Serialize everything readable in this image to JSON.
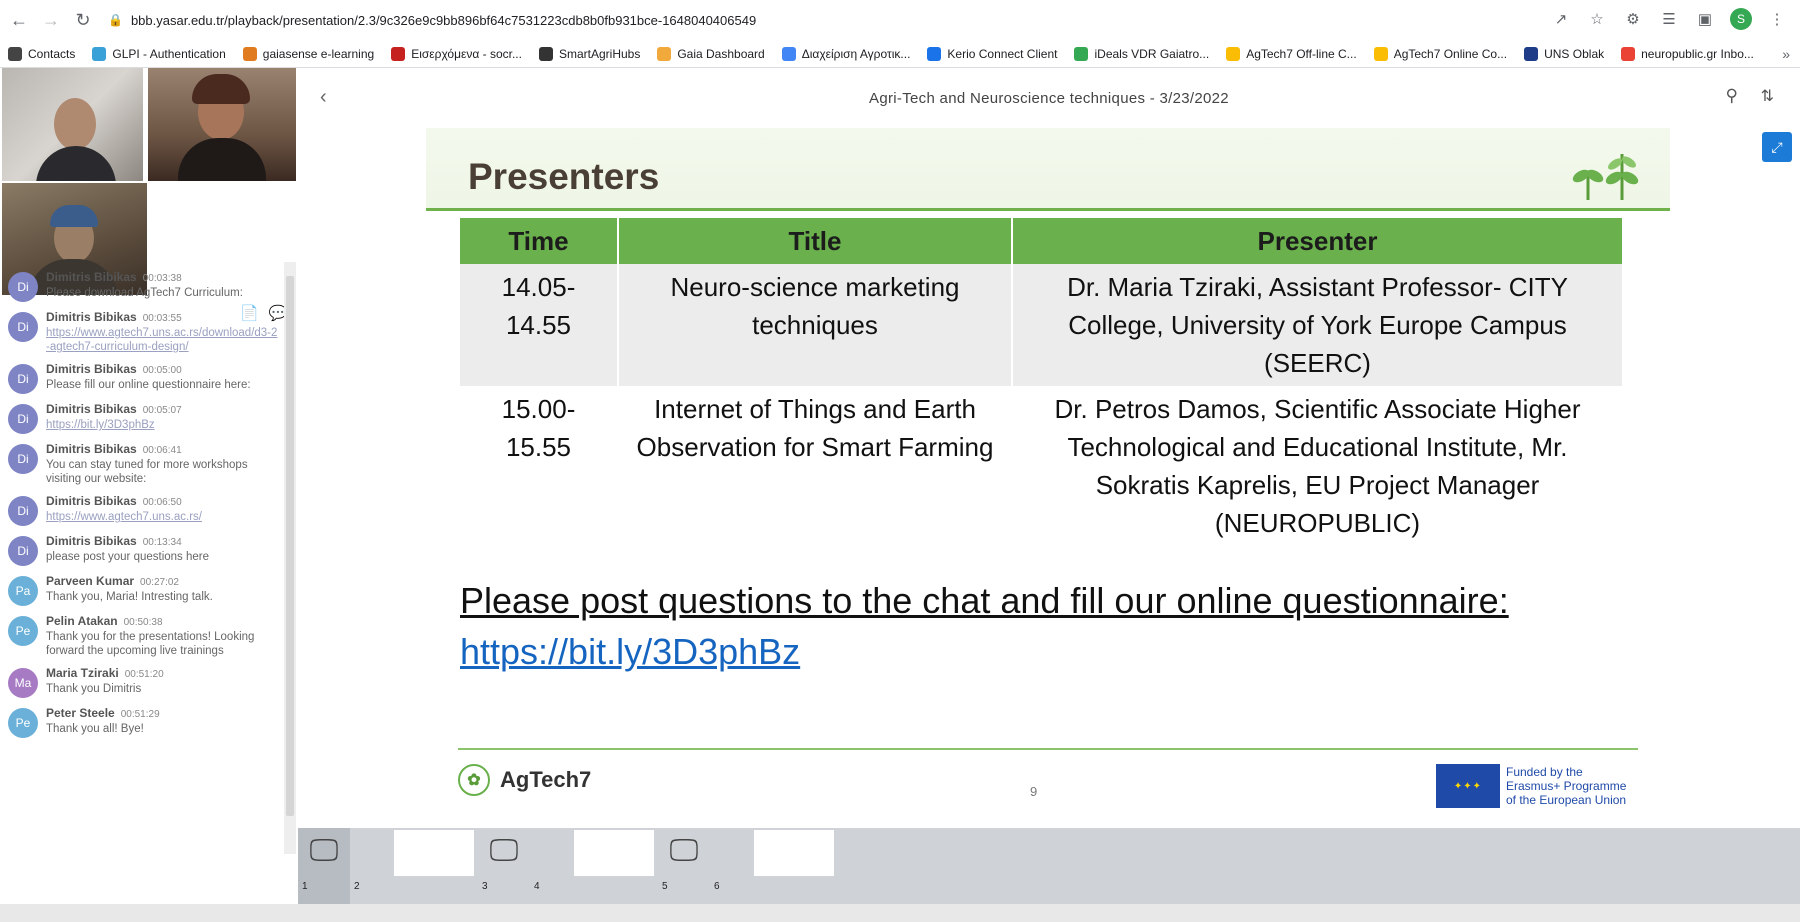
{
  "browser": {
    "url": "bbb.yasar.edu.tr/playback/presentation/2.3/9c326e9c9bb896bf64c7531223cdb8b0fb931bce-1648040406549",
    "profile_initial": "S",
    "bookmarks": [
      {
        "label": "Contacts",
        "color": "#444444"
      },
      {
        "label": "GLPI - Authentication",
        "color": "#3aa0d8"
      },
      {
        "label": "gaiasense e-learning",
        "color": "#e07b20"
      },
      {
        "label": "Εισερχόμενα - socr...",
        "color": "#c5221f"
      },
      {
        "label": "SmartAgriHubs",
        "color": "#333333"
      },
      {
        "label": "Gaia Dashboard",
        "color": "#f2a93b"
      },
      {
        "label": "Διαχείριση Αγροτικ...",
        "color": "#4285f4"
      },
      {
        "label": "Kerio Connect Client",
        "color": "#1a73e8"
      },
      {
        "label": "iDeals VDR Gaiatro...",
        "color": "#34a853"
      },
      {
        "label": "AgTech7 Off-line C...",
        "color": "#fbbc04"
      },
      {
        "label": "AgTech7 Online Co...",
        "color": "#fbbc04"
      },
      {
        "label": "UNS Oblak",
        "color": "#1f3c88"
      },
      {
        "label": "neuropublic.gr Inbo...",
        "color": "#ea4335"
      }
    ]
  },
  "player": {
    "title": "Agri-Tech and Neuroscience techniques - 3/23/2022"
  },
  "chat": [
    {
      "initials": "Di",
      "name": "Dimitris Bibikas",
      "time": "00:03:38",
      "text": "Please download AgTech7 Curriculum:",
      "color": "#7e84c4"
    },
    {
      "initials": "Di",
      "name": "Dimitris Bibikas",
      "time": "00:03:55",
      "link": "https://www.agtech7.uns.ac.rs/download/d3-2-agtech7-curriculum-design/",
      "color": "#7e84c4"
    },
    {
      "initials": "Di",
      "name": "Dimitris Bibikas",
      "time": "00:05:00",
      "text": "Please fill our online questionnaire here:",
      "color": "#7e84c4"
    },
    {
      "initials": "Di",
      "name": "Dimitris Bibikas",
      "time": "00:05:07",
      "link": "https://bit.ly/3D3phBz",
      "color": "#7e84c4"
    },
    {
      "initials": "Di",
      "name": "Dimitris Bibikas",
      "time": "00:06:41",
      "text": "You can stay tuned for more workshops visiting our website:",
      "color": "#7e84c4"
    },
    {
      "initials": "Di",
      "name": "Dimitris Bibikas",
      "time": "00:06:50",
      "link": "https://www.agtech7.uns.ac.rs/",
      "color": "#7e84c4"
    },
    {
      "initials": "Di",
      "name": "Dimitris Bibikas",
      "time": "00:13:34",
      "text": "please post your questions here",
      "color": "#7e84c4"
    },
    {
      "initials": "Pa",
      "name": "Parveen Kumar",
      "time": "00:27:02",
      "text": "Thank you, Maria! Intresting talk.",
      "color": "#6ab0d8"
    },
    {
      "initials": "Pe",
      "name": "Pelin Atakan",
      "time": "00:50:38",
      "text": "Thank you for the presentations! Looking forward the upcoming  live trainings",
      "color": "#6ab0d8"
    },
    {
      "initials": "Ma",
      "name": "Maria Tziraki",
      "time": "00:51:20",
      "text": "Thank you Dimitris",
      "color": "#a77bc4"
    },
    {
      "initials": "Pe",
      "name": "Peter Steele",
      "time": "00:51:29",
      "text": "Thank you all! Bye!",
      "color": "#6ab0d8"
    }
  ],
  "slide": {
    "title": "Presenters",
    "headers": [
      "Time",
      "Title",
      "Presenter"
    ],
    "rows": [
      {
        "time": "14.05-14.55",
        "title": "Neuro-science marketing techniques",
        "presenter": "Dr. Maria Tziraki, Assistant Professor- CITY College, University of York Europe Campus (SEERC)"
      },
      {
        "time": "15.00-15.55",
        "title": "Internet of Things and Earth Observation for Smart Farming",
        "presenter": "Dr. Petros Damos, Scientific Associate Higher Technological and Educational Institute, Mr. Sokratis Kaprelis, EU Project Manager (NEUROPUBLIC)"
      }
    ],
    "cta": "Please post questions to the chat and fill our online questionnaire:",
    "cta_link": "https://bit.ly/3D3phBz",
    "brand": "AgTech7",
    "page_number": "9",
    "eu_text_1": "Funded by the",
    "eu_text_2": "Erasmus+ Programme",
    "eu_text_3": "of the European Union"
  },
  "thumbnails": [
    {
      "num": "1",
      "type": "monitor",
      "selected": true
    },
    {
      "num": "2",
      "type": "blank"
    },
    {
      "num": "3",
      "type": "monitor"
    },
    {
      "num": "4",
      "type": "blank"
    },
    {
      "num": "5",
      "type": "monitor"
    },
    {
      "num": "6",
      "type": "blank"
    }
  ],
  "icons": {
    "back": "chevron-left-icon",
    "forward": "chevron-right-icon",
    "reload": "reload-icon",
    "lock": "lock-icon",
    "share": "share-icon",
    "star": "star-icon",
    "extensions": "puzzle-icon",
    "search": "search-icon",
    "refresh": "swap-icon",
    "fullscreen": "fullscreen-icon",
    "notes": "notes-icon",
    "chat": "chat-icon",
    "monitor": "monitor-icon"
  }
}
